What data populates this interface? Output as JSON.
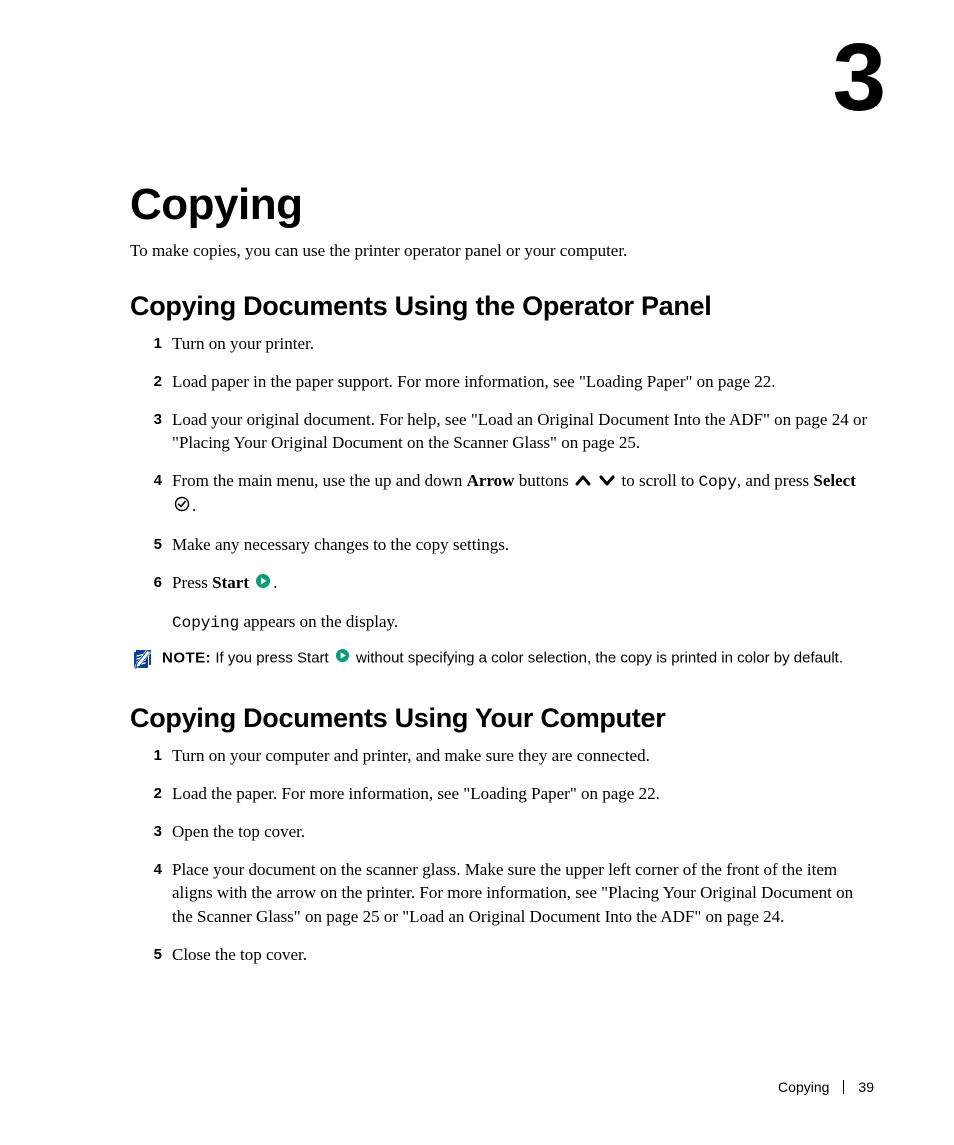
{
  "chapter": {
    "number": "3",
    "title": "Copying",
    "intro": "To make copies, you can use the printer operator panel or your computer."
  },
  "section1": {
    "heading": "Copying Documents Using the Operator Panel",
    "steps": {
      "s1": "Turn on your printer.",
      "s2": "Load paper in the paper support. For more information, see \"Loading Paper\" on page 22.",
      "s3": "Load your original document. For help, see \"Load an Original Document Into the ADF\" on page 24 or \"Placing Your Original Document on the Scanner Glass\" on page 25.",
      "s4_a": "From the main menu, use the up and down ",
      "s4_arrow_label": "Arrow",
      "s4_b": " buttons ",
      "s4_c": " to scroll to ",
      "s4_copy": "Copy",
      "s4_d": ", and press ",
      "s4_select_label": "Select",
      "s4_e": " ",
      "s4_f": ".",
      "s5": "Make any necessary changes to the copy settings.",
      "s6_a": "Press ",
      "s6_start_label": "Start",
      "s6_b": " ",
      "s6_c": ".",
      "s6_sub_a": "Copying",
      "s6_sub_b": " appears on the display."
    },
    "note": {
      "label": "NOTE:",
      "a": " If you press Start ",
      "b": " without specifying a color selection, the copy is printed in color by default."
    }
  },
  "section2": {
    "heading": "Copying Documents Using Your Computer",
    "steps": {
      "s1": "Turn on your computer and printer, and make sure they are connected.",
      "s2": "Load the paper. For more information, see \"Loading Paper\" on page 22.",
      "s3": "Open the top cover.",
      "s4": "Place your document on the scanner glass. Make sure the upper left corner of the front of the item aligns with the arrow on the printer. For more information, see \"Placing Your Original Document on the Scanner Glass\" on page 25 or \"Load an Original Document Into the ADF\" on page 24.",
      "s5": "Close the top cover."
    }
  },
  "footer": {
    "title": "Copying",
    "page": "39"
  }
}
